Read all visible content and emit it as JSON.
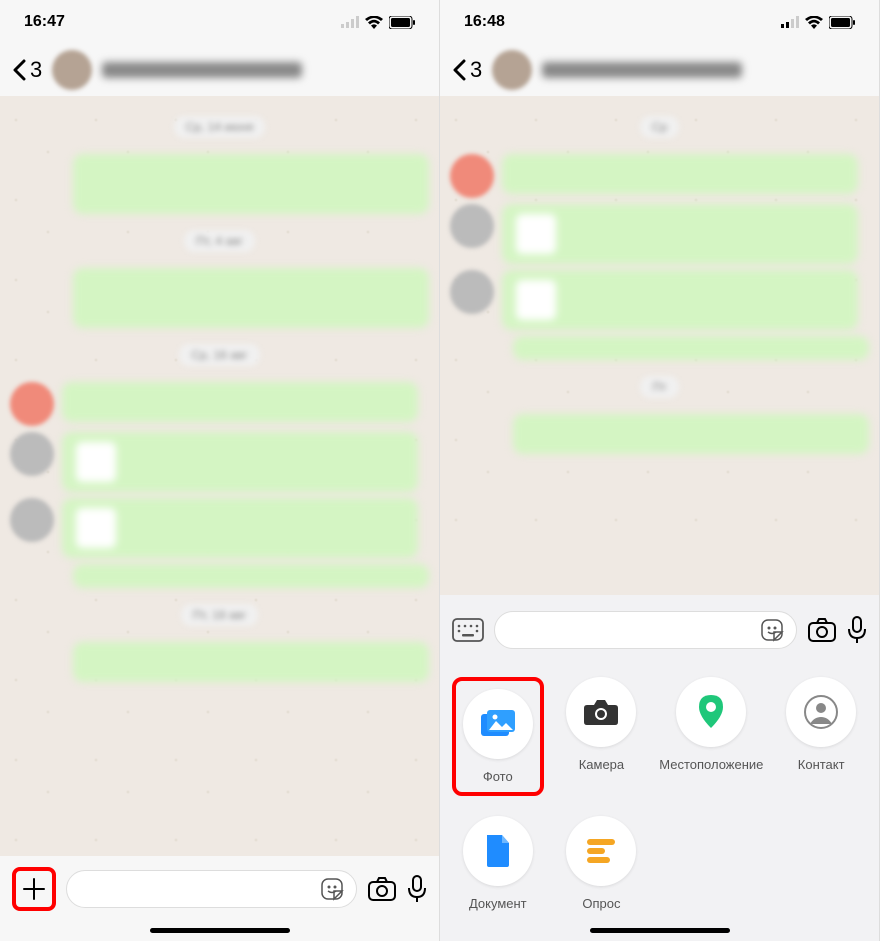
{
  "left": {
    "time": "16:47",
    "back_count": "3"
  },
  "right": {
    "time": "16:48",
    "back_count": "3"
  },
  "attach": {
    "photo": "Фото",
    "camera": "Камера",
    "location": "Местоположение",
    "contact": "Контакт",
    "document": "Документ",
    "poll": "Опрос"
  },
  "icons": {
    "plus": "+",
    "sticker": "sticker-icon",
    "camera": "camera-icon",
    "mic": "mic-icon"
  }
}
